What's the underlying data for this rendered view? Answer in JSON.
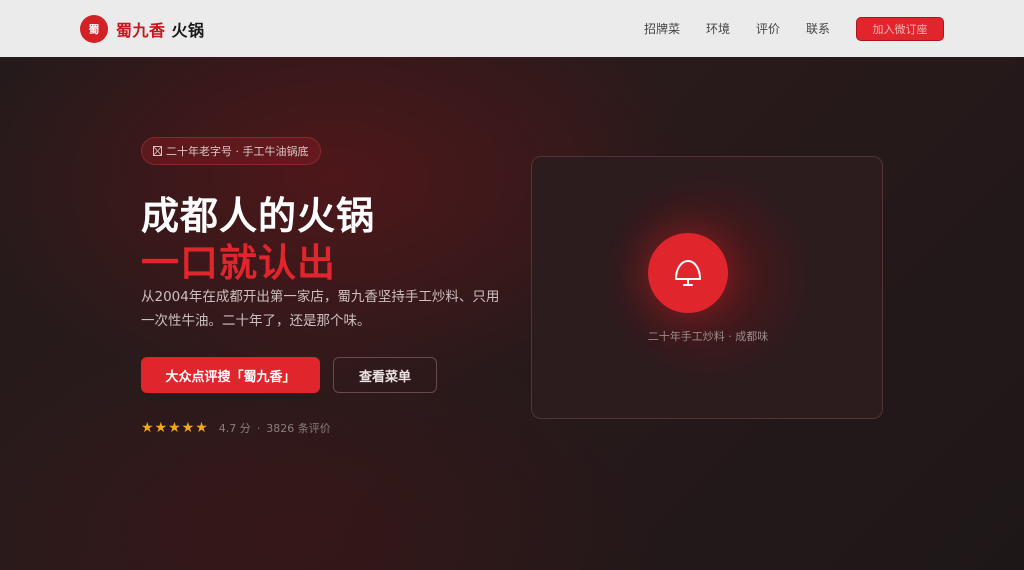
{
  "header": {
    "logo_badge": "蜀",
    "brand_name": "蜀九香",
    "brand_suffix": "火锅",
    "nav": [
      "招牌菜",
      "环境",
      "评价",
      "联系"
    ],
    "order_button": "加入微订座"
  },
  "hero": {
    "tag": "二十年老字号 · 手工牛油锅底",
    "title_line1": "成都人的火锅",
    "title_line2": "一口就认出",
    "description": "从2004年在成都开出第一家店，蜀九香坚持手工炒料、只用一次性牛油。二十年了，还是那个味。",
    "primary_button": "大众点评搜「蜀九香」",
    "secondary_button": "查看菜单",
    "rating": {
      "stars": "★★★★★",
      "score": "4.7 分",
      "reviews": "3826 条评价"
    }
  },
  "card": {
    "icon": "hotpot-bell-icon",
    "caption": "二十年手工炒料 · 成都味"
  },
  "colors": {
    "accent": "#e0262c",
    "star": "#f2a81d",
    "header_bg": "#ebebeb",
    "hero_bg": "#241a1b"
  }
}
